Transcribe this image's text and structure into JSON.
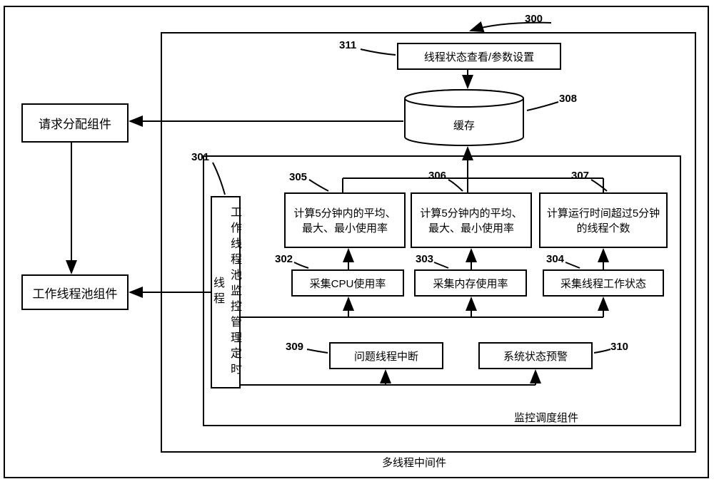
{
  "diagram": {
    "ref300": "300",
    "box_request": "请求分配组件",
    "box_threadpool": "工作线程池组件",
    "ref301": "301",
    "box_monitor_thread": "工作线程池监控管理定时线程",
    "ref302": "302",
    "box_collect_cpu": "采集CPU使用率",
    "ref303": "303",
    "box_collect_mem": "采集内存使用率",
    "ref304": "304",
    "box_collect_thread": "采集线程工作状态",
    "ref305": "305",
    "box_calc_cpu": "计算5分钟内的平均、最大、最小使用率",
    "ref306": "306",
    "box_calc_mem": "计算5分钟内的平均、最大、最小使用率",
    "ref307": "307",
    "box_calc_thread": "计算运行时间超过5分钟的线程个数",
    "ref308": "308",
    "cache_label": "缓存",
    "ref309": "309",
    "box_problem_interrupt": "问题线程中断",
    "ref310": "310",
    "box_system_alert": "系统状态预警",
    "ref311": "311",
    "box_view_params": "线程状态查看/参数设置",
    "inner_caption": "监控调度组件",
    "outer_caption": "多线程中间件"
  }
}
